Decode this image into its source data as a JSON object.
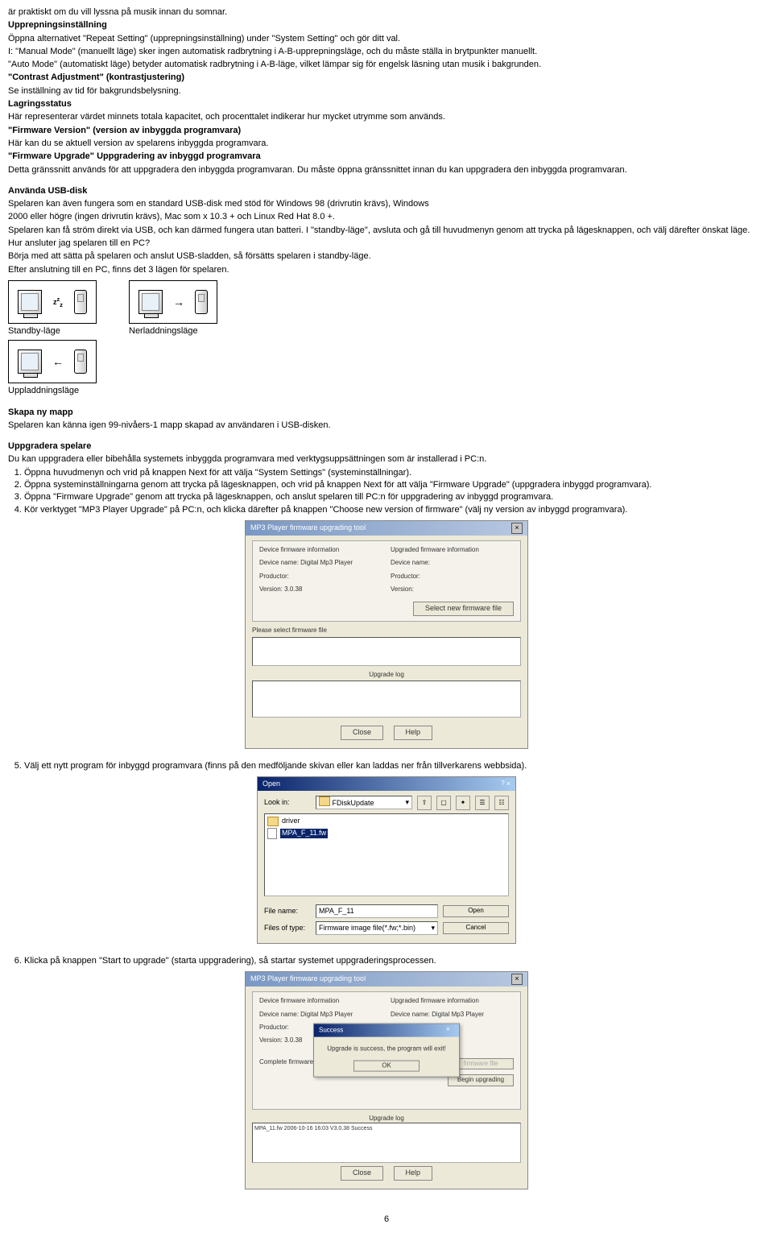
{
  "intro": {
    "line1": "är praktiskt om du vill lyssna på musik innan du somnar.",
    "heading1": "Upprepningsinställning",
    "line2": "Öppna alternativet \"Repeat Setting\" (upprepningsinställning) under \"System Setting\" och gör ditt val.",
    "line3": "I: \"Manual Mode\" (manuellt läge) sker ingen automatisk radbrytning i A-B-upprepningsläge, och du måste ställa in brytpunkter manuellt.",
    "line4": "\"Auto Mode\" (automatiskt läge) betyder automatisk radbrytning i A-B-läge, vilket lämpar sig för engelsk läsning utan musik i bakgrunden.",
    "heading2": "\"Contrast Adjustment\" (kontrastjustering)",
    "line5": "Se inställning av tid för bakgrundsbelysning.",
    "heading3": "Lagringsstatus",
    "line6": "Här representerar värdet minnets totala kapacitet, och procenttalet indikerar hur mycket utrymme som används.",
    "heading4": "\"Firmware Version\" (version av inbyggda programvara)",
    "line7": "Här kan du se aktuell version av spelarens inbyggda programvara.",
    "heading5": "\"Firmware Upgrade\" Uppgradering av inbyggd programvara",
    "line8": "Detta gränssnitt används för att uppgradera den inbyggda programvaran. Du måste öppna gränssnittet innan du kan uppgradera den inbyggda programvaran."
  },
  "usb": {
    "heading": "Använda USB-disk",
    "line1": "Spelaren kan även fungera som en standard USB-disk med stöd för Windows 98 (drivrutin krävs), Windows",
    "line2": "2000 eller högre (ingen drivrutin krävs), Mac som x 10.3 + och Linux Red Hat 8.0 +.",
    "line3": "Spelaren kan få ström direkt via USB, och kan därmed fungera utan batteri. I \"standby-läge\", avsluta och gå till huvudmenyn genom att trycka på lägesknappen, och välj därefter önskat läge.",
    "line4": "Hur ansluter jag spelaren till en PC?",
    "line5": "Börja med att sätta på spelaren och anslut USB-sladden, så försätts spelaren i standby-läge.",
    "line6": "Efter anslutning till en PC, finns det 3 lägen för spelaren.",
    "label_standby": "Standby-läge",
    "label_download": "Nerladdningsläge",
    "label_upload": "Uppladdningsläge"
  },
  "newfolder": {
    "heading": "Skapa ny mapp",
    "line1": "Spelaren kan känna igen 99-nivåers-1 mapp skapad av användaren i USB-disken."
  },
  "upgrade": {
    "heading": "Uppgradera spelare",
    "line1": "Du kan uppgradera eller bibehålla systemets inbyggda programvara med verktygsuppsättningen som är installerad i PC:n.",
    "step1": "Öppna huvudmenyn och vrid på knappen Next för att välja \"System Settings\" (systeminställningar).",
    "step2": "Öppna systeminställningarna genom att trycka på lägesknappen, och vrid på knappen Next för att välja \"Firmware Upgrade\" (uppgradera inbyggd programvara).",
    "step3": "Öppna \"Firmware Upgrade\" genom att trycka på lägesknappen, och anslut spelaren till PC:n för uppgradering av inbyggd programvara.",
    "step4": "Kör verktyget \"MP3 Player Upgrade\" på PC:n, och klicka därefter på knappen \"Choose new version of firmware\" (välj ny version av inbyggd programvara).",
    "step5": "Välj ett nytt program för inbyggd programvara (finns på den medföljande skivan eller kan laddas ner från tillverkarens webbsida).",
    "step6": "Klicka på knappen \"Start to upgrade\" (starta uppgradering), så startar systemet uppgraderingsprocessen."
  },
  "dialog1": {
    "title": "MP3 Player firmware upgrading tool",
    "grp1_title": "Device firmware information",
    "grp2_title": "Upgraded firmware information",
    "dev_name_lbl": "Device name:",
    "dev_name_val": "Digital Mp3 Player",
    "prod_lbl": "Productor:",
    "ver_lbl": "Version:",
    "ver_val": "3.0.38",
    "select_btn": "Select new firmware file",
    "please_select": "Please select firmware file",
    "upgrade_log": "Upgrade log",
    "close": "Close",
    "help": "Help"
  },
  "dialog2": {
    "title": "Open",
    "look_in": "Look in:",
    "look_in_val": "FDiskUpdate",
    "folder_driver": "driver",
    "file_name": "MPA_F_11.fw",
    "file_name_lbl": "File name:",
    "file_name_val": "MPA_F_11",
    "file_type_lbl": "Files of type:",
    "file_type_val": "Firmware image file(*.fw;*.bin)",
    "open_btn": "Open",
    "cancel_btn": "Cancel"
  },
  "dialog3": {
    "title": "MP3 Player firmware upgrading tool",
    "dev_name2": "Digital Mp3 Player",
    "ver2": "3.0.38",
    "complete": "Complete firmware upg",
    "firmware_file": "firmware file",
    "begin": "Begin upgrading",
    "success_title": "Success",
    "success_msg": "Upgrade is success, the program will exit!",
    "ok": "OK",
    "log_line": "MPA_11.fw  2006-10-16  16:03  V3.0.38  Success"
  },
  "page_number": "6"
}
